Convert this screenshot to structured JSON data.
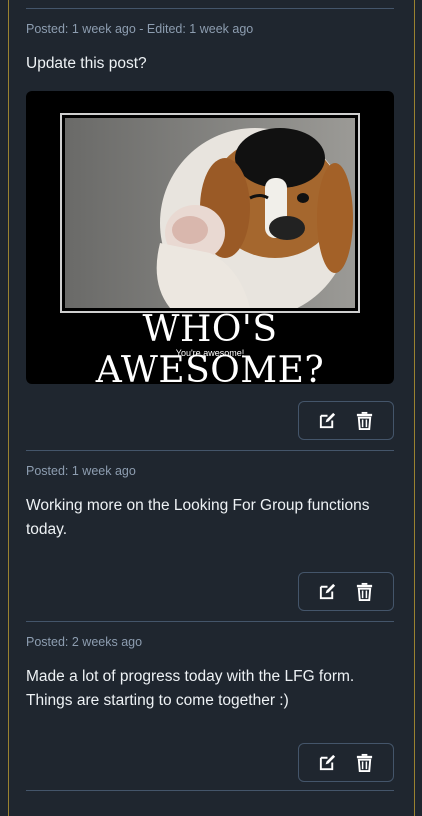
{
  "posts": [
    {
      "meta": "Posted: 1 week ago - Edited: 1 week ago",
      "body": "Update this post?",
      "image": {
        "title": "WHO'S AWESOME?",
        "subtitle": "You're awesome!"
      }
    },
    {
      "meta": "Posted: 1 week ago",
      "body": "Working more on the Looking For Group functions today."
    },
    {
      "meta": "Posted: 2 weeks ago",
      "body": "Made a lot of progress today with the LFG form. Things are starting to come together :)"
    }
  ],
  "icons": {
    "edit": "edit-icon",
    "delete": "trash-icon"
  },
  "colors": {
    "background": "#1f262f",
    "divider": "#44556a",
    "frame": "#9a8230",
    "meta_text": "#8d9db0"
  }
}
